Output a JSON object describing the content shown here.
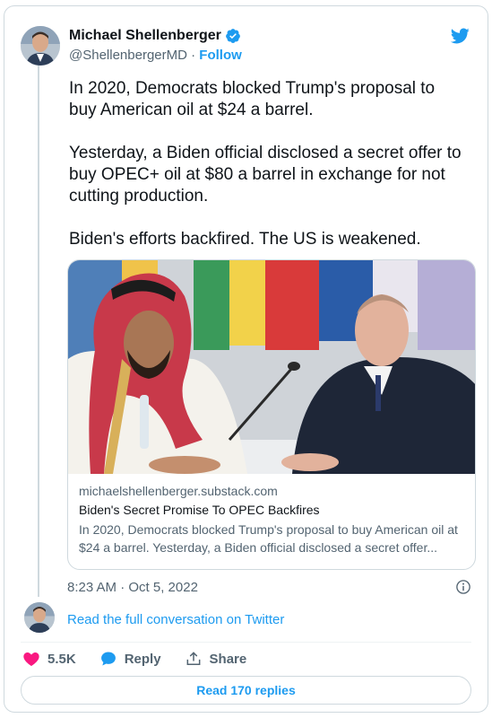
{
  "author": {
    "name": "Michael Shellenberger",
    "handle": "@ShellenbergerMD",
    "separator": "·",
    "follow_label": "Follow"
  },
  "tweet": {
    "paragraphs": [
      "In 2020, Democrats blocked Trump's proposal to buy American oil at $24 a barrel.",
      "Yesterday, a Biden official disclosed a secret offer to buy OPEC+ oil at $80 a barrel in exchange for not cutting production.",
      "Biden's efforts backfired. The US is weakened."
    ]
  },
  "link_card": {
    "domain": "michaelshellenberger.substack.com",
    "title": "Biden's Secret Promise To OPEC Backfires",
    "description": "In 2020, Democrats blocked Trump's proposal to buy American oil at $24 a barrel. Yesterday, a Biden official disclosed a secret offer..."
  },
  "timestamp": "8:23 AM · Oct 5, 2022",
  "read_conversation_label": "Read the full conversation on Twitter",
  "actions": {
    "likes": "5.5K",
    "reply_label": "Reply",
    "share_label": "Share"
  },
  "read_replies_label": "Read 170 replies",
  "colors": {
    "accent": "#1d9bf0",
    "like": "#f91880",
    "muted": "#536471"
  },
  "icons": [
    "verified-badge-icon",
    "twitter-bird-icon",
    "info-icon",
    "heart-icon",
    "reply-icon",
    "share-icon"
  ]
}
